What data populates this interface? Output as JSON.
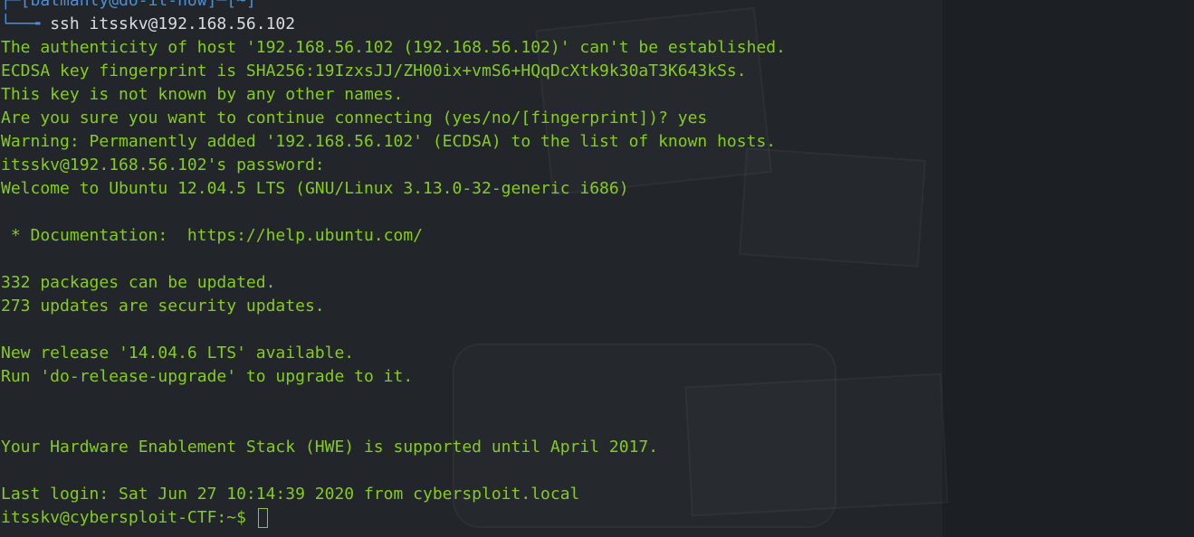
{
  "prompt": {
    "tree_top": "┌─[",
    "user": "batmanly",
    "at": "@",
    "host": "do-it-now",
    "sep": "]─[",
    "dir": "~",
    "close": "]",
    "tree_bottom": "└──╼ ",
    "symbol": "$",
    "command": "ssh itsskv@192.168.56.102"
  },
  "output_lines": [
    "The authenticity of host '192.168.56.102 (192.168.56.102)' can't be established.",
    "ECDSA key fingerprint is SHA256:19IzxsJJ/ZH00ix+vmS6+HQqDcXtk9k30aT3K643kSs.",
    "This key is not known by any other names.",
    "Are you sure you want to continue connecting (yes/no/[fingerprint])? yes",
    "Warning: Permanently added '192.168.56.102' (ECDSA) to the list of known hosts.",
    "itsskv@192.168.56.102's password:",
    "Welcome to Ubuntu 12.04.5 LTS (GNU/Linux 3.13.0-32-generic i686)",
    "",
    " * Documentation:  https://help.ubuntu.com/",
    "",
    "332 packages can be updated.",
    "273 updates are security updates.",
    "",
    "New release '14.04.6 LTS' available.",
    "Run 'do-release-upgrade' to upgrade to it.",
    "",
    "",
    "Your Hardware Enablement Stack (HWE) is supported until April 2017.",
    "",
    "Last login: Sat Jun 27 10:14:39 2020 from cybersploit.local"
  ],
  "remote_prompt": "itsskv@cybersploit-CTF:~$ ",
  "colors": {
    "output_text": "#85cc1e",
    "prompt_accent": "#4d8fd6",
    "command_text": "#d9dde3",
    "background": "#22262b"
  }
}
